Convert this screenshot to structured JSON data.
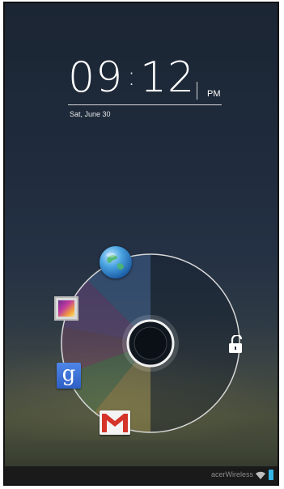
{
  "lockscreen": {
    "time_hour": "09",
    "time_separator": ":",
    "time_minute": "12",
    "ampm": "PM",
    "date": "Sat, June 30"
  },
  "unlock_ring": {
    "targets": [
      {
        "name": "browser",
        "icon": "globe-icon"
      },
      {
        "name": "gallery",
        "icon": "gallery-icon"
      },
      {
        "name": "google-search",
        "icon": "google-search-icon",
        "glyph": "g"
      },
      {
        "name": "gmail",
        "icon": "gmail-icon"
      },
      {
        "name": "unlock",
        "icon": "unlock-icon"
      }
    ]
  },
  "status_bar": {
    "network": "acerWireless",
    "wifi_icon": "wifi-icon",
    "battery_icon": "battery-icon"
  },
  "colors": {
    "accent": "#33b5e5",
    "ring": "#d8d8d8"
  }
}
